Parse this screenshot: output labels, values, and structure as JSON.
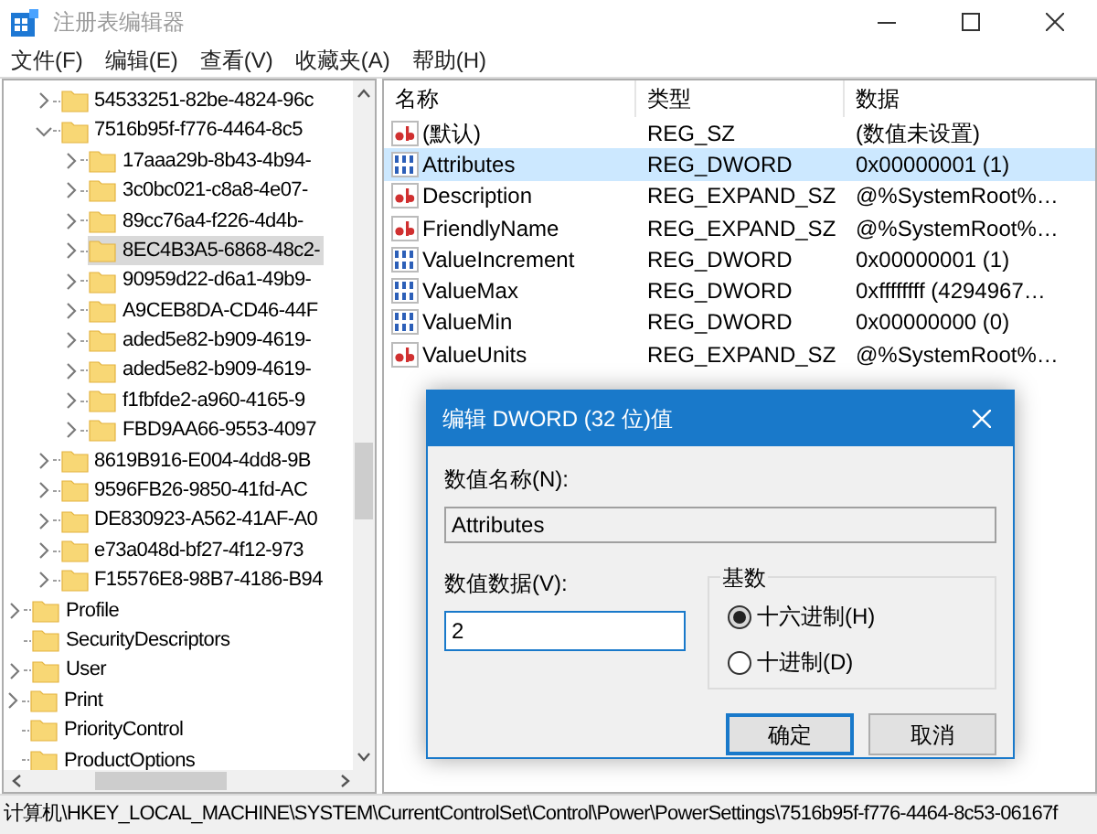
{
  "window": {
    "title": "注册表编辑器"
  },
  "menu": [
    "文件(F)",
    "编辑(E)",
    "查看(V)",
    "收藏夹(A)",
    "帮助(H)"
  ],
  "tree": [
    {
      "children": [
        {
          "children": [
            {
              "label": "54533251-82be-4824-96c",
              "kind": "branch",
              "expanded": false,
              "selected": false
            },
            {
              "label": "7516b95f-f776-4464-8c5",
              "kind": "branch",
              "expanded": true,
              "selected": false,
              "children": [
                {
                  "label": "17aaa29b-8b43-4b94-",
                  "kind": "branch",
                  "expanded": false,
                  "selected": false
                },
                {
                  "label": "3c0bc021-c8a8-4e07-",
                  "kind": "branch",
                  "expanded": false,
                  "selected": false
                },
                {
                  "label": "89cc76a4-f226-4d4b-",
                  "kind": "branch",
                  "expanded": false,
                  "selected": false
                },
                {
                  "label": "8EC4B3A5-6868-48c2-",
                  "kind": "branch",
                  "expanded": false,
                  "selected": true
                },
                {
                  "label": "90959d22-d6a1-49b9-",
                  "kind": "branch",
                  "expanded": false,
                  "selected": false
                },
                {
                  "label": "A9CEB8DA-CD46-44F",
                  "kind": "branch",
                  "expanded": false,
                  "selected": false
                },
                {
                  "label": "aded5e82-b909-4619-",
                  "kind": "branch",
                  "expanded": false,
                  "selected": false
                },
                {
                  "label": "aded5e82-b909-4619-",
                  "kind": "branch",
                  "expanded": false,
                  "selected": false
                },
                {
                  "label": "f1fbfde2-a960-4165-9",
                  "kind": "branch",
                  "expanded": false,
                  "selected": false
                },
                {
                  "label": "FBD9AA66-9553-4097",
                  "kind": "branch",
                  "expanded": false,
                  "selected": false
                }
              ]
            },
            {
              "label": "8619B916-E004-4dd8-9B",
              "kind": "branch",
              "expanded": false,
              "selected": false
            },
            {
              "label": "9596FB26-9850-41fd-AC",
              "kind": "branch",
              "expanded": false,
              "selected": false
            },
            {
              "label": "DE830923-A562-41AF-A0",
              "kind": "branch",
              "expanded": false,
              "selected": false
            },
            {
              "label": "e73a048d-bf27-4f12-973",
              "kind": "branch",
              "expanded": false,
              "selected": false
            },
            {
              "label": "F15576E8-98B7-4186-B94",
              "kind": "branch",
              "expanded": false,
              "selected": false
            }
          ]
        },
        {
          "label": "Profile",
          "kind": "branch",
          "expanded": false,
          "selected": false
        },
        {
          "label": "SecurityDescriptors",
          "kind": "leaf",
          "selected": false
        },
        {
          "label": "User",
          "kind": "branch",
          "expanded": false,
          "selected": false
        }
      ]
    },
    {
      "label": "Print",
      "kind": "branch",
      "expanded": false,
      "selected": false
    },
    {
      "label": "PriorityControl",
      "kind": "leaf",
      "selected": false
    },
    {
      "label": "ProductOptions",
      "kind": "leaf",
      "selected": false
    }
  ],
  "values": {
    "columns": [
      "名称",
      "类型",
      "数据"
    ],
    "rows": [
      {
        "kind": "string",
        "name": "(默认)",
        "type": "REG_SZ",
        "data": "(数值未设置)",
        "selected": false
      },
      {
        "kind": "number",
        "name": "Attributes",
        "type": "REG_DWORD",
        "data": "0x00000001 (1)",
        "selected": true
      },
      {
        "kind": "string",
        "name": "Description",
        "type": "REG_EXPAND_SZ",
        "data": "@%SystemRoot%…",
        "selected": false
      },
      {
        "kind": "string",
        "name": "FriendlyName",
        "type": "REG_EXPAND_SZ",
        "data": "@%SystemRoot%…",
        "selected": false
      },
      {
        "kind": "number",
        "name": "ValueIncrement",
        "type": "REG_DWORD",
        "data": "0x00000001 (1)",
        "selected": false
      },
      {
        "kind": "number",
        "name": "ValueMax",
        "type": "REG_DWORD",
        "data": "0xffffffff (4294967…",
        "selected": false
      },
      {
        "kind": "number",
        "name": "ValueMin",
        "type": "REG_DWORD",
        "data": "0x00000000 (0)",
        "selected": false
      },
      {
        "kind": "string",
        "name": "ValueUnits",
        "type": "REG_EXPAND_SZ",
        "data": "@%SystemRoot%…",
        "selected": false
      }
    ]
  },
  "dialog": {
    "title": "编辑 DWORD (32 位)值",
    "name_label": "数值名称(N):",
    "name_value": "Attributes",
    "data_label": "数值数据(V):",
    "data_value": "2",
    "base": {
      "title": "基数",
      "options": [
        {
          "label": "十六进制(H)",
          "selected": true
        },
        {
          "label": "十进制(D)",
          "selected": false
        }
      ]
    },
    "buttons": [
      {
        "label": "确定",
        "default": true
      },
      {
        "label": "取消",
        "default": false
      }
    ]
  },
  "status_bar": "计算机\\HKEY_LOCAL_MACHINE\\SYSTEM\\CurrentControlSet\\Control\\Power\\PowerSettings\\7516b95f-f776-4464-8c53-06167f"
}
